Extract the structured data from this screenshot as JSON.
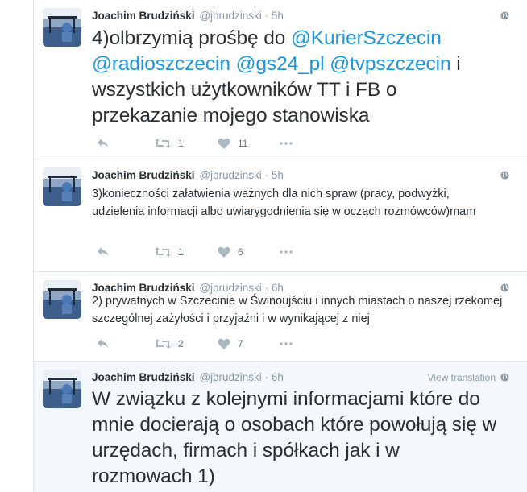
{
  "tweets": [
    {
      "fullname": "Joachim Brudziński",
      "handle": "@jbrudzinski",
      "separator": "·",
      "time": "5h",
      "text_parts": [
        {
          "t": "4)olbrzymią prośbę do ",
          "m": false
        },
        {
          "t": "@KurierSzczecin",
          "m": true
        },
        {
          "t": " ",
          "m": false
        },
        {
          "t": "@radioszczecin",
          "m": true
        },
        {
          "t": " ",
          "m": false
        },
        {
          "t": "@gs24_pl",
          "m": true
        },
        {
          "t": " ",
          "m": false
        },
        {
          "t": "@tvpszczecin",
          "m": true
        },
        {
          "t": " i wszystkich użytkowników TT i FB o przekazanie mojego stanowiska",
          "m": false
        }
      ],
      "retweets": "1",
      "likes": "11",
      "view_translation": ""
    },
    {
      "fullname": "Joachim Brudziński",
      "handle": "@jbrudzinski",
      "separator": "·",
      "time": "5h",
      "text_parts": [
        {
          "t": "3)konieczności załatwienia ważnych dla nich spraw (pracy, podwyżki, udzielenia informacji albo uwiarygodnienia się w oczach rozmówców)mam",
          "m": false
        }
      ],
      "retweets": "1",
      "likes": "6",
      "view_translation": ""
    },
    {
      "fullname": "Joachim Brudziński",
      "handle": "@jbrudzinski",
      "separator": "·",
      "time": "6h",
      "text_parts": [
        {
          "t": "2) prywatnych w Szczecinie w Świnoujściu i innych miastach o naszej rzekomej szczególnej zażyłości i przyjaźni i w wynikającej z niej",
          "m": false
        }
      ],
      "retweets": "2",
      "likes": "7",
      "view_translation": ""
    },
    {
      "fullname": "Joachim Brudziński",
      "handle": "@jbrudzinski",
      "separator": "·",
      "time": "6h",
      "text_parts": [
        {
          "t": "W związku z kolejnymi informacjami które do mnie docierają o osobach które powołują się w urzędach, firmach i spółkach jak i w rozmowach 1)",
          "m": false
        }
      ],
      "retweets": "",
      "likes": "",
      "view_translation": "View translation"
    }
  ],
  "icons": {
    "reply": "reply-icon",
    "retweet": "retweet-icon",
    "like": "heart-icon",
    "more": "more-icon",
    "globe": "globe-icon"
  },
  "colors": {
    "mention": "#1b95e0",
    "meta": "#8899a6",
    "text": "#292f33",
    "action": "#aab8c2",
    "border": "#e1e8ed"
  }
}
